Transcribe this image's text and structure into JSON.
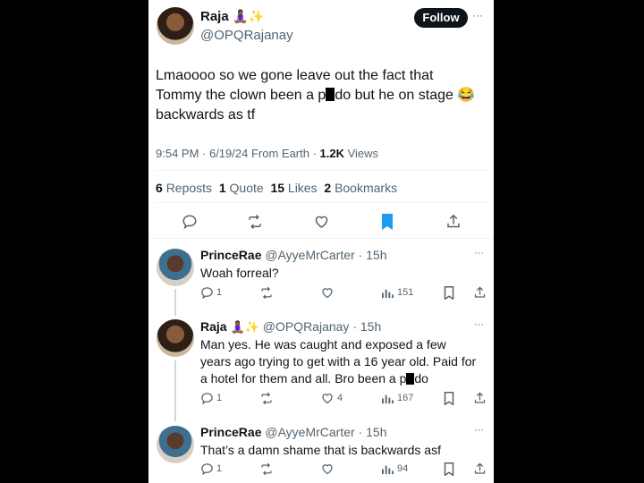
{
  "tweet": {
    "name": "Raja",
    "name_emoji": "🧘🏾‍♀️✨",
    "handle": "@OPQRajanay",
    "follow_label": "Follow",
    "more": "···",
    "text_line1": "Lmaoooo so we gone leave out the fact that",
    "text_line2a": "Tommy the clown been a p",
    "text_line2b": "do but he on stage",
    "text_line2_emoji": "😂",
    "text_line3": "backwards as tf",
    "time": "9:54 PM · 6/19/24 From Earth · ",
    "views_count": "1.2K",
    "views_label": " Views",
    "reposts_count": "6",
    "reposts_label": "Reposts",
    "quote_count": "1",
    "quote_label": "Quote",
    "likes_count": "15",
    "likes_label": "Likes",
    "bookmarks_count": "2",
    "bookmarks_label": "Bookmarks"
  },
  "replies": [
    {
      "name": "PrinceRae",
      "handle": "@AyyeMrCarter · 15h",
      "text1": "Woah forreal?",
      "reply_count": "1",
      "like_count": "",
      "view_count": "151",
      "more": "···"
    },
    {
      "name": "Raja",
      "name_emoji": "🧘🏾‍♀️✨",
      "handle": "@OPQRajanay · 15h",
      "text1": "Man yes. He was caught and exposed a few",
      "text2": "years ago trying to get with a 16 year old. Paid for",
      "text3a": "a hotel for them and all. Bro been a p",
      "text3b": "do",
      "reply_count": "1",
      "like_count": "4",
      "view_count": "167",
      "more": "···"
    },
    {
      "name": "PrinceRae",
      "handle": "@AyyeMrCarter · 15h",
      "text1": "That’s a damn shame that is backwards asf",
      "reply_count": "1",
      "like_count": "",
      "view_count": "94",
      "more": "···"
    }
  ],
  "colors": {
    "accent": "#1d9bf0",
    "text": "#0f1419",
    "muted": "#536471",
    "bookmark_active": "#1d9bf0"
  },
  "icons": [
    "reply-icon",
    "repost-icon",
    "like-icon",
    "bookmark-icon",
    "share-icon",
    "views-icon"
  ]
}
